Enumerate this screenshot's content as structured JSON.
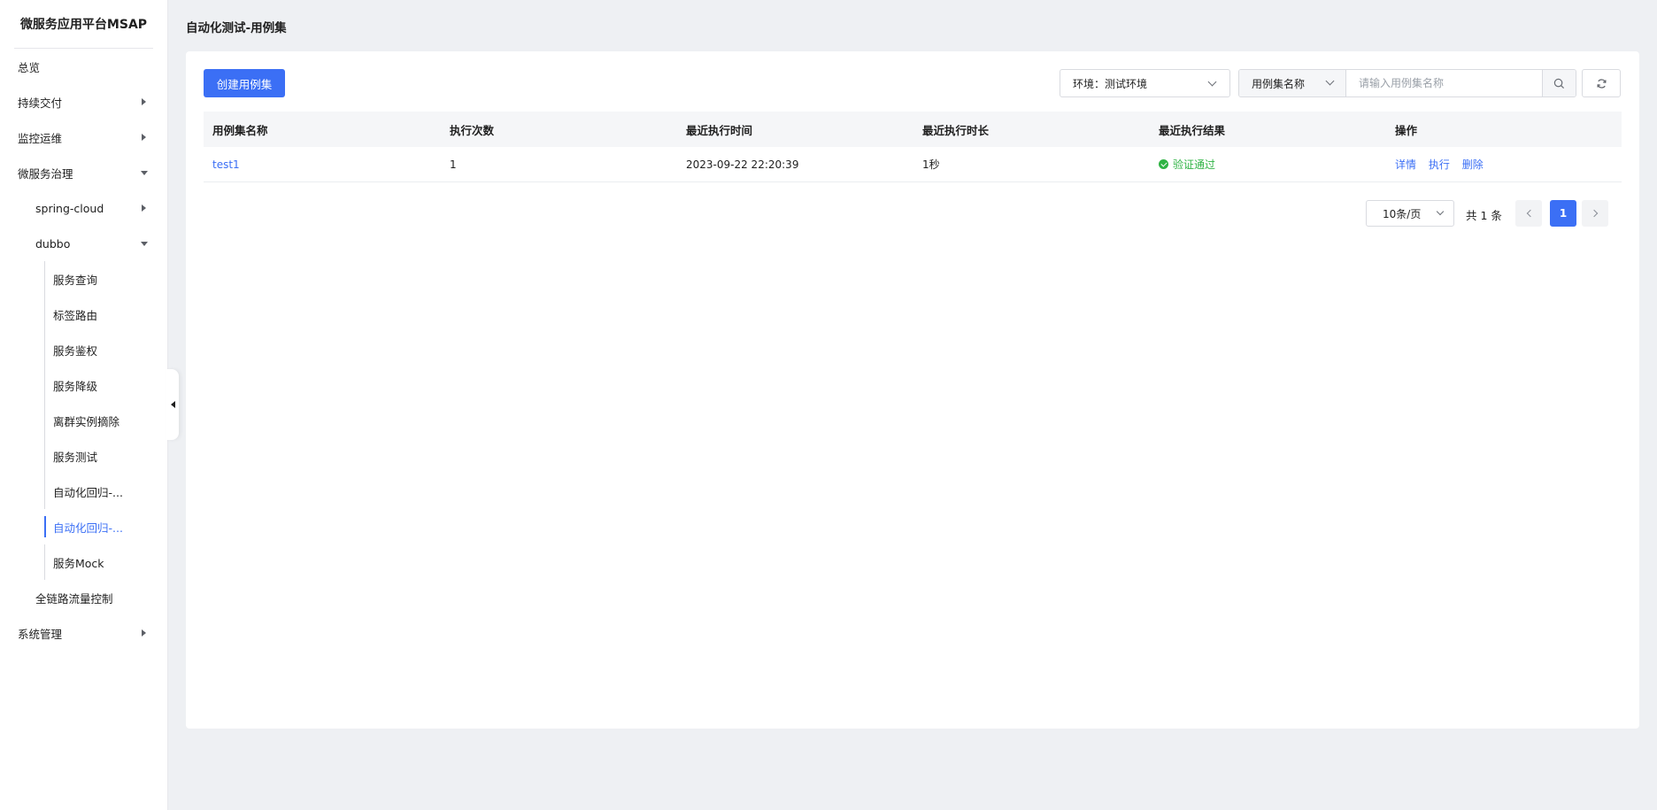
{
  "app": {
    "title": "微服务应用平台MSAP"
  },
  "sidebar": {
    "items": [
      {
        "label": "总览",
        "level": 1,
        "caret": "none"
      },
      {
        "label": "持续交付",
        "level": 1,
        "caret": "right"
      },
      {
        "label": "监控运维",
        "level": 1,
        "caret": "right"
      },
      {
        "label": "微服务治理",
        "level": 1,
        "caret": "down"
      },
      {
        "label": "spring-cloud",
        "level": 2,
        "caret": "right"
      },
      {
        "label": "dubbo",
        "level": 2,
        "caret": "down"
      },
      {
        "label": "服务查询",
        "level": 3,
        "caret": "none"
      },
      {
        "label": "标签路由",
        "level": 3,
        "caret": "none"
      },
      {
        "label": "服务鉴权",
        "level": 3,
        "caret": "none"
      },
      {
        "label": "服务降级",
        "level": 3,
        "caret": "none"
      },
      {
        "label": "离群实例摘除",
        "level": 3,
        "caret": "none"
      },
      {
        "label": "服务测试",
        "level": 3,
        "caret": "none"
      },
      {
        "label": "自动化回归-...",
        "level": 3,
        "caret": "none"
      },
      {
        "label": "自动化回归-...",
        "level": 3,
        "caret": "none",
        "active": true
      },
      {
        "label": "服务Mock",
        "level": 3,
        "caret": "none"
      },
      {
        "label": "全链路流量控制",
        "level": 2,
        "caret": "none"
      },
      {
        "label": "系统管理",
        "level": 1,
        "caret": "right"
      }
    ]
  },
  "page": {
    "title": "自动化测试-用例集"
  },
  "toolbar": {
    "create_label": "创建用例集",
    "env_select": "环境：测试环境",
    "field_select": "用例集名称",
    "search_placeholder": "请输入用例集名称"
  },
  "table": {
    "headers": [
      "用例集名称",
      "执行次数",
      "最近执行时间",
      "最近执行时长",
      "最近执行结果",
      "操作"
    ],
    "rows": [
      {
        "name": "test1",
        "count": "1",
        "last_time": "2023-09-22 22:20:39",
        "duration": "1秒",
        "result": "验证通过",
        "actions": [
          "详情",
          "执行",
          "删除"
        ]
      }
    ]
  },
  "pagination": {
    "page_size": "10条/页",
    "total": "共 1 条",
    "current_page": "1"
  },
  "colors": {
    "primary": "#3b6ff5",
    "success": "#2fb344",
    "background": "#eef0f3"
  }
}
